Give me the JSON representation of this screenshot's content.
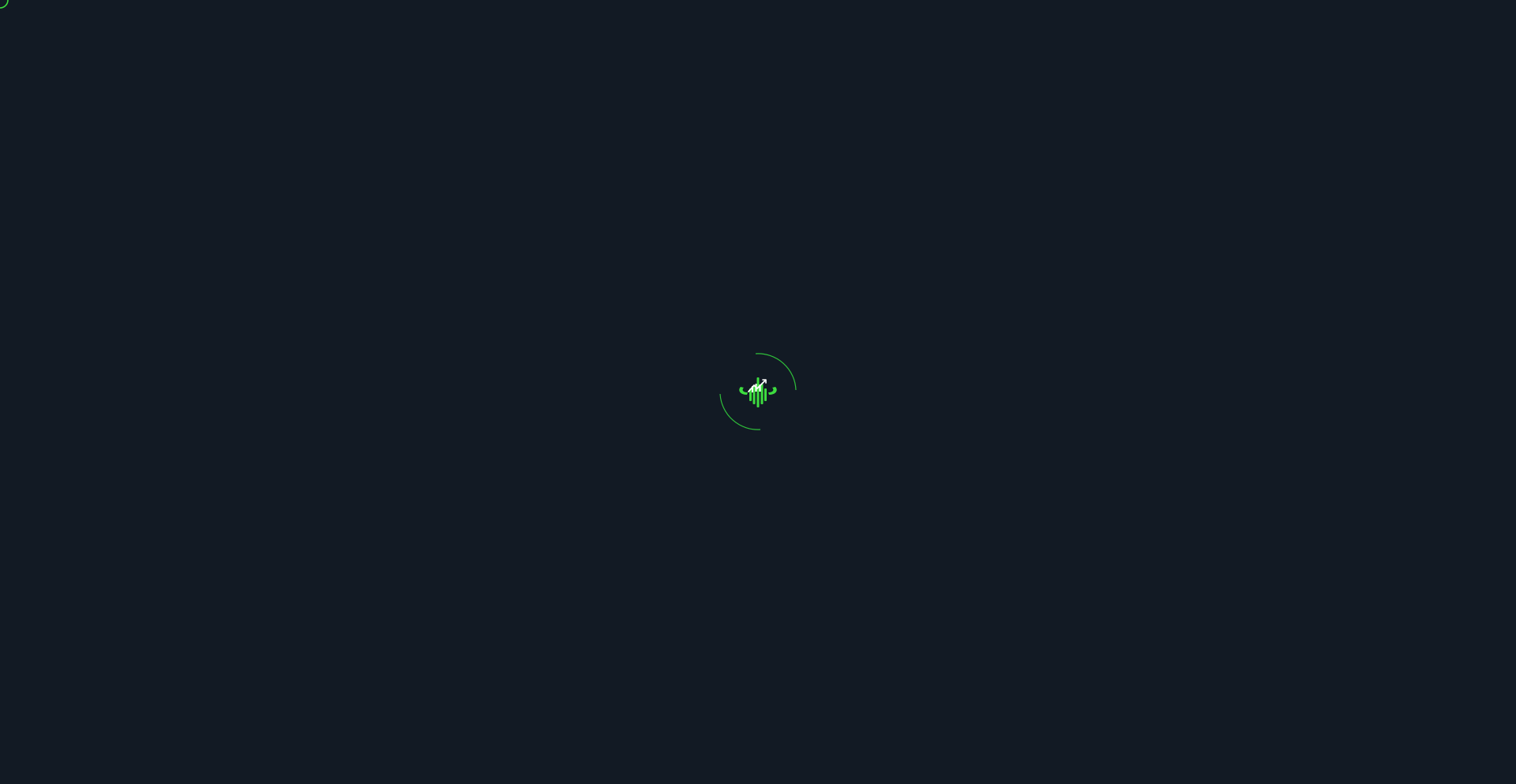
{
  "screen": {
    "state": "loading",
    "background_color": "#121a24"
  },
  "loader": {
    "icon": "spinner-arcs-icon",
    "color": "#2fbf3a"
  },
  "logo": {
    "icon": "bull-chart-logo-icon",
    "primary_color": "#3ddc3f",
    "accent_color": "#ffffff"
  },
  "cursor": {
    "icon": "cursor-ring-icon",
    "color": "#3ddc3f"
  }
}
